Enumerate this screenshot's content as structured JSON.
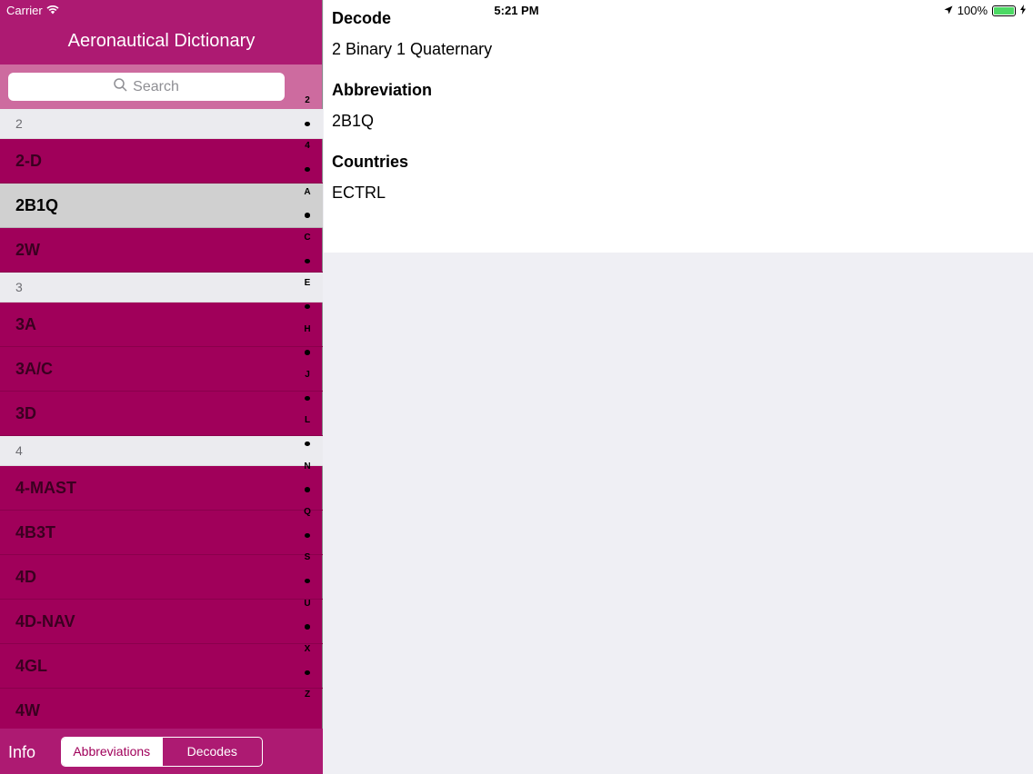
{
  "status": {
    "carrier": "Carrier",
    "time": "5:21 PM",
    "battery": "100%"
  },
  "nav": {
    "title": "Aeronautical Dictionary"
  },
  "search": {
    "placeholder": "Search"
  },
  "list": {
    "sections": [
      {
        "header": "2",
        "rows": [
          "2-D",
          "2B1Q",
          "2W"
        ]
      },
      {
        "header": "3",
        "rows": [
          "3A",
          "3A/C",
          "3D"
        ]
      },
      {
        "header": "4",
        "rows": [
          "4-MAST",
          "4B3T",
          "4D",
          "4D-NAV",
          "4GL",
          "4W"
        ]
      }
    ],
    "selected": "2B1Q"
  },
  "index": [
    "2",
    "4",
    "A",
    "C",
    "E",
    "H",
    "J",
    "L",
    "N",
    "Q",
    "S",
    "U",
    "X",
    "Z"
  ],
  "tabbar": {
    "info": "Info",
    "segments": [
      "Abbreviations",
      "Decodes"
    ],
    "selected": 0
  },
  "detail": {
    "decode_label": "Decode",
    "decode_value": "2 Binary 1 Quaternary",
    "abbreviation_label": "Abbreviation",
    "abbreviation_value": "2B1Q",
    "countries_label": "Countries",
    "countries_value": "ECTRL"
  },
  "colors": {
    "accent": "#a0005a",
    "nav": "#ad1a72",
    "search_bar": "#cd6b9f"
  }
}
